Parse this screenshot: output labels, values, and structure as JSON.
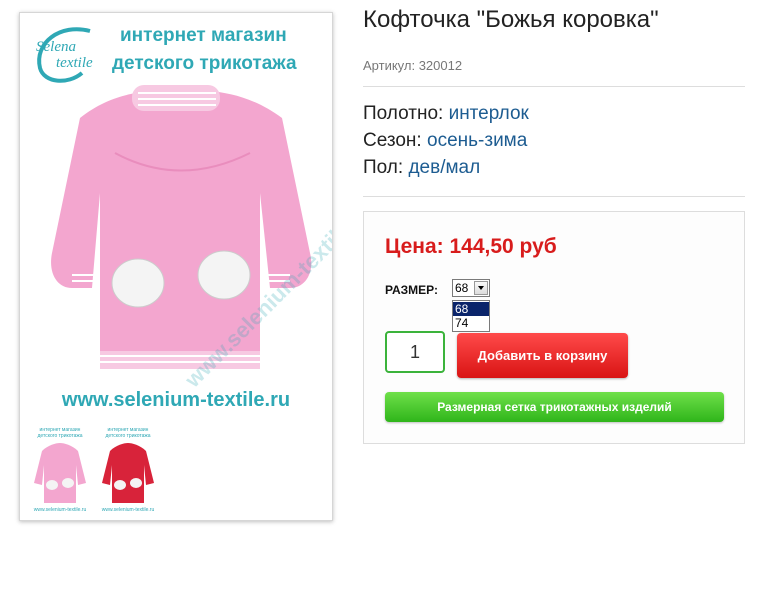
{
  "product": {
    "title": "Кофточка \"Божья коровка\"",
    "sku_label": "Артикул: 320012",
    "attributes": [
      {
        "label": "Полотно:",
        "value": "интерлок"
      },
      {
        "label": "Сезон:",
        "value": "осень-зима"
      },
      {
        "label": "Пол:",
        "value": "дев/мал"
      }
    ]
  },
  "gallery": {
    "logo_line1": "Selena",
    "logo_line2": "textile",
    "banner_line1": "интернет магазин",
    "banner_line2": "детского трикотажа",
    "watermark": "www.selenium-textile.ru",
    "site_url": "www.selenium-textile.ru",
    "thumb_caption_line1": "интернет магазин",
    "thumb_caption_line2": "детского трикотажа",
    "thumb_url": "www.selenium-textile.ru",
    "thumbnails": [
      {
        "color": "pink"
      },
      {
        "color": "red"
      }
    ]
  },
  "buy": {
    "price": "Цена: 144,50 руб",
    "size_label": "РАЗМЕР:",
    "size_selected": "68",
    "size_options": [
      "68",
      "74"
    ],
    "quantity": "1",
    "add_to_cart": "Добавить в корзину",
    "size_chart": "Размерная сетка трикотажных изделий"
  },
  "colors": {
    "price": "#d81c1c",
    "attr_value": "#1d5c91",
    "add_button": "#e02020",
    "size_chart_button": "#3cc026",
    "brand_teal": "#2fa8b5",
    "pink_garment": "#f3a6cf"
  }
}
